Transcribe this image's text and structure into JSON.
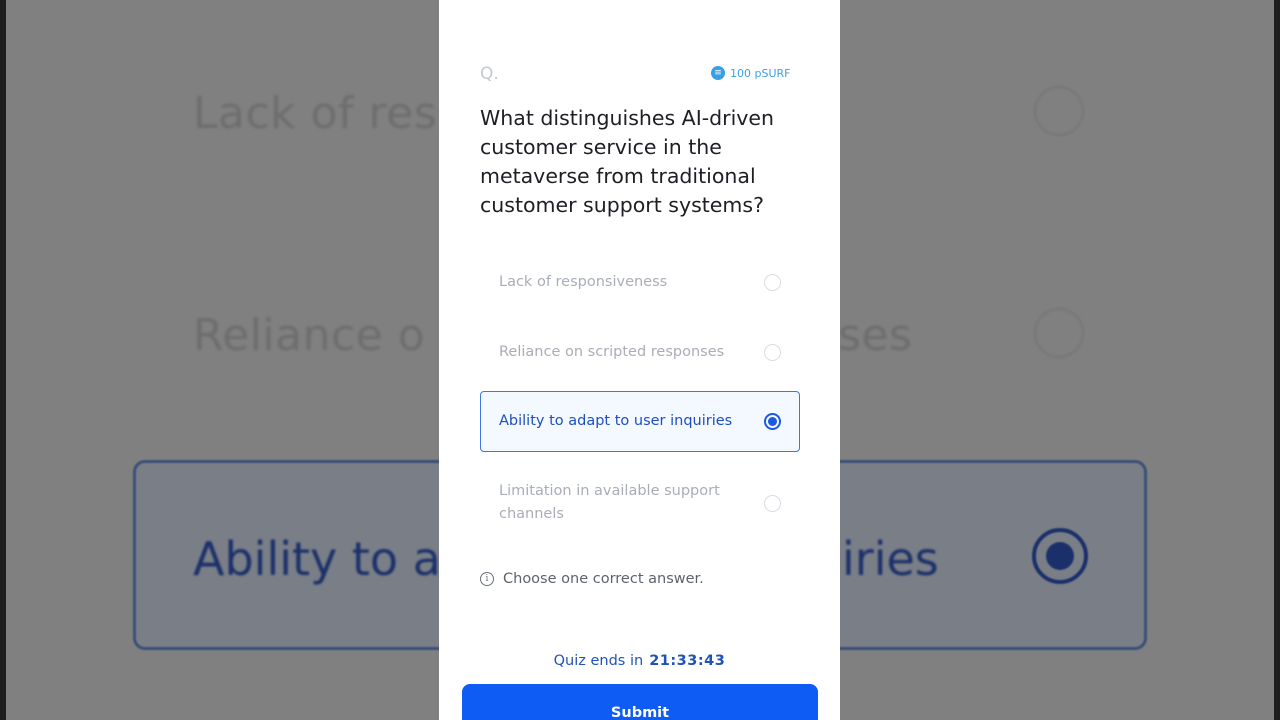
{
  "question": {
    "label": "Q.",
    "reward": "100 pSURF",
    "reward_icon": "coin-icon",
    "text": "What distinguishes AI-driven customer service in the metaverse from traditional customer support systems?"
  },
  "options": [
    {
      "label": "Lack of responsiveness",
      "selected": false
    },
    {
      "label": "Reliance on scripted responses",
      "selected": false
    },
    {
      "label": "Ability to adapt to user inquiries",
      "selected": true
    },
    {
      "label": "Limitation in available support channels",
      "selected": false
    }
  ],
  "hint": "Choose one correct answer.",
  "timer": {
    "label": "Quiz ends in",
    "value": "21:33:43"
  },
  "submit_label": "Submit",
  "background": {
    "line1": "Lack of res",
    "line2a": "Reliance o",
    "line2b": "ses",
    "line3a": "Ability to a",
    "line3b": "iries"
  },
  "colors": {
    "accent": "#0f5cf5",
    "selected_text": "#1e4fbf",
    "reward": "#3aa0e6"
  }
}
